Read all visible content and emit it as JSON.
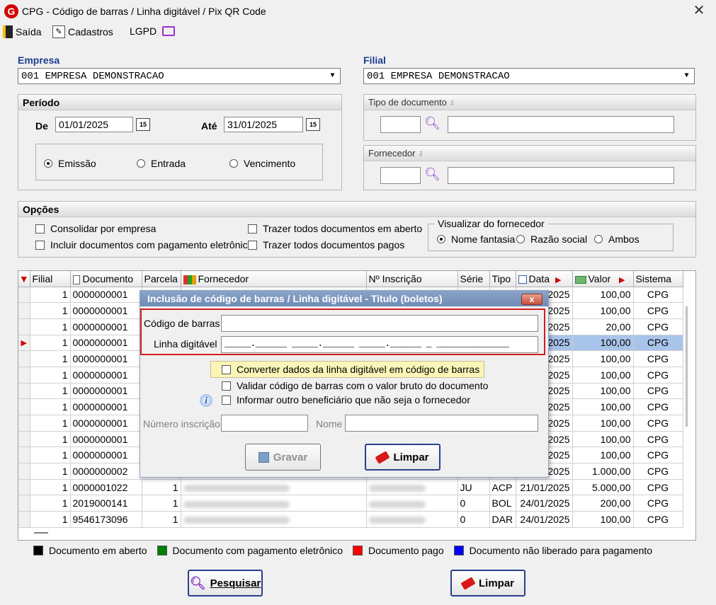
{
  "window": {
    "title": "CPG - Código de barras / Linha digitável / Pix QR Code",
    "logo": "G"
  },
  "menu": [
    {
      "label": "Saída",
      "icon": "exit-door-icon"
    },
    {
      "label": "Cadastros",
      "icon": "notepad-pencil-icon"
    },
    {
      "label": "LGPD",
      "icon": "monitor-icon"
    }
  ],
  "empresa": {
    "label": "Empresa",
    "value": "001 EMPRESA DEMONSTRACAO"
  },
  "filial": {
    "label": "Filial",
    "value": "001 EMPRESA DEMONSTRACAO"
  },
  "periodo": {
    "label": "Período",
    "de_label": "De",
    "de_value": "01/01/2025",
    "ate_label": "Até",
    "ate_value": "31/01/2025",
    "cal_label": "15",
    "radios": [
      {
        "label": "Emissão",
        "checked": true
      },
      {
        "label": "Entrada",
        "checked": false
      },
      {
        "label": "Vencimento",
        "checked": false
      }
    ]
  },
  "tipo_documento": {
    "label": "Tipo de documento"
  },
  "fornecedor": {
    "label": "Fornecedor"
  },
  "opcoes": {
    "label": "Opções",
    "checks": [
      "Consolidar por empresa",
      "Incluir documentos com pagamento eletrônico",
      "Trazer todos documentos em aberto",
      "Trazer todos documentos pagos"
    ],
    "visualizar": {
      "label": "Visualizar do fornecedor",
      "options": [
        {
          "label": "Nome fantasia",
          "checked": true
        },
        {
          "label": "Razão social",
          "checked": false
        },
        {
          "label": "Ambos",
          "checked": false
        }
      ]
    }
  },
  "grid": {
    "columns": [
      "Filial",
      "Documento",
      "Parcela",
      "Fornecedor",
      "Nº Inscrição",
      "Série",
      "Tipo",
      "Data",
      "Valor",
      "Sistema"
    ],
    "rows": [
      {
        "filial": "1",
        "documento": "0000000001",
        "parcela": "",
        "serie": "",
        "tipo": "",
        "data": "2025",
        "valor": "100,00",
        "sistema": "CPG"
      },
      {
        "filial": "1",
        "documento": "0000000001",
        "parcela": "",
        "serie": "",
        "tipo": "",
        "data": "2025",
        "valor": "100,00",
        "sistema": "CPG"
      },
      {
        "filial": "1",
        "documento": "0000000001",
        "parcela": "",
        "serie": "",
        "tipo": "",
        "data": "2025",
        "valor": "20,00",
        "sistema": "CPG"
      },
      {
        "filial": "1",
        "documento": "0000000001",
        "parcela": "",
        "serie": "",
        "tipo": "",
        "data": "2025",
        "valor": "100,00",
        "sistema": "CPG",
        "selected": true
      },
      {
        "filial": "1",
        "documento": "0000000001",
        "parcela": "",
        "serie": "",
        "tipo": "",
        "data": "2025",
        "valor": "100,00",
        "sistema": "CPG"
      },
      {
        "filial": "1",
        "documento": "0000000001",
        "parcela": "",
        "serie": "",
        "tipo": "",
        "data": "2025",
        "valor": "100,00",
        "sistema": "CPG"
      },
      {
        "filial": "1",
        "documento": "0000000001",
        "parcela": "",
        "serie": "",
        "tipo": "",
        "data": "2025",
        "valor": "100,00",
        "sistema": "CPG"
      },
      {
        "filial": "1",
        "documento": "0000000001",
        "parcela": "",
        "serie": "",
        "tipo": "",
        "data": "2025",
        "valor": "100,00",
        "sistema": "CPG"
      },
      {
        "filial": "1",
        "documento": "0000000001",
        "parcela": "",
        "serie": "",
        "tipo": "",
        "data": "2025",
        "valor": "100,00",
        "sistema": "CPG"
      },
      {
        "filial": "1",
        "documento": "0000000001",
        "parcela": "",
        "serie": "",
        "tipo": "",
        "data": "2025",
        "valor": "100,00",
        "sistema": "CPG"
      },
      {
        "filial": "1",
        "documento": "0000000001",
        "parcela": "",
        "serie": "",
        "tipo": "",
        "data": "2025",
        "valor": "100,00",
        "sistema": "CPG"
      },
      {
        "filial": "1",
        "documento": "0000000002",
        "parcela": "",
        "serie": "",
        "tipo": "",
        "data": "2025",
        "valor": "1.000,00",
        "sistema": "CPG"
      },
      {
        "filial": "1",
        "documento": "0000001022",
        "parcela": "1",
        "serie": "JU",
        "tipo": "ACP",
        "data": "21/01/2025",
        "valor": "5.000,00",
        "sistema": "CPG"
      },
      {
        "filial": "1",
        "documento": "2019000141",
        "parcela": "1",
        "serie": "0",
        "tipo": "BOL",
        "data": "24/01/2025",
        "valor": "200,00",
        "sistema": "CPG"
      },
      {
        "filial": "1",
        "documento": "9546173096",
        "parcela": "1",
        "serie": "0",
        "tipo": "DAR",
        "data": "24/01/2025",
        "valor": "100,00",
        "sistema": "CPG"
      }
    ]
  },
  "legend": [
    {
      "label": "Documento em aberto",
      "color": "#000000"
    },
    {
      "label": "Documento com pagamento eletrônico",
      "color": "#008000"
    },
    {
      "label": "Documento pago",
      "color": "#ff0000"
    },
    {
      "label": "Documento não liberado para pagamento",
      "color": "#0000ff"
    }
  ],
  "buttons": {
    "pesquisar": "Pesquisar",
    "limpar": "Limpar"
  },
  "dialog": {
    "title": "Inclusão de código de barras / Linha digitável - Titulo (boletos)",
    "close": "x",
    "codigo_label": "Código de barras",
    "codigo_value": "",
    "linha_label": "Linha digitável",
    "linha_mask": "_____.______ _____.______ _____.______ _ ______________",
    "checks": [
      {
        "label": "Converter dados da linha digitável em código de barras",
        "checked": false
      },
      {
        "label": "Validar código de barras com o valor bruto do documento",
        "checked": false
      },
      {
        "label": "Informar outro beneficiário que não seja o fornecedor",
        "checked": false
      }
    ],
    "numero_label": "Número inscrição",
    "nome_label": "Nome",
    "gravar": "Gravar",
    "limpar": "Limpar"
  }
}
